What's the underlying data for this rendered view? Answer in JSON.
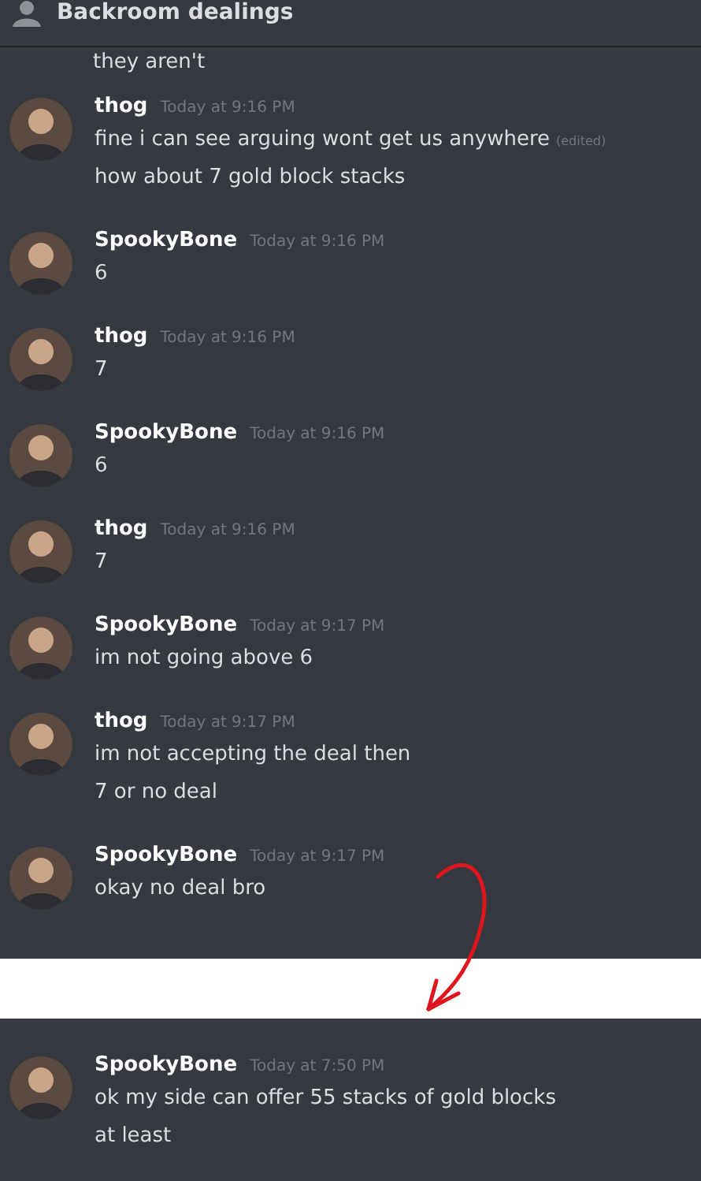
{
  "header": {
    "title": "Backroom dealings"
  },
  "panels": [
    {
      "cut_line": "they aren't",
      "messages": [
        {
          "author": "thog",
          "time": "Today at 9:16 PM",
          "lines": [
            {
              "text": "fine i can see arguing wont get us anywhere",
              "edited": "(edited)"
            },
            {
              "text": "how about 7 gold block stacks"
            }
          ]
        },
        {
          "author": "SpookyBone",
          "time": "Today at 9:16 PM",
          "lines": [
            {
              "text": "6"
            }
          ]
        },
        {
          "author": "thog",
          "time": "Today at 9:16 PM",
          "lines": [
            {
              "text": "7"
            }
          ]
        },
        {
          "author": "SpookyBone",
          "time": "Today at 9:16 PM",
          "lines": [
            {
              "text": "6"
            }
          ]
        },
        {
          "author": "thog",
          "time": "Today at 9:16 PM",
          "lines": [
            {
              "text": "7"
            }
          ]
        },
        {
          "author": "SpookyBone",
          "time": "Today at 9:17 PM",
          "lines": [
            {
              "text": "im not going above 6"
            }
          ]
        },
        {
          "author": "thog",
          "time": "Today at 9:17 PM",
          "lines": [
            {
              "text": "im not accepting the deal then"
            },
            {
              "text": "7 or no deal"
            }
          ]
        },
        {
          "author": "SpookyBone",
          "time": "Today at 9:17 PM",
          "lines": [
            {
              "text": "okay no deal bro"
            }
          ]
        }
      ]
    },
    {
      "messages": [
        {
          "author": "SpookyBone",
          "time": "Today at 7:50 PM",
          "lines": [
            {
              "text": "ok my side can offer 55 stacks of gold blocks"
            },
            {
              "text": "at least"
            }
          ]
        }
      ]
    }
  ]
}
